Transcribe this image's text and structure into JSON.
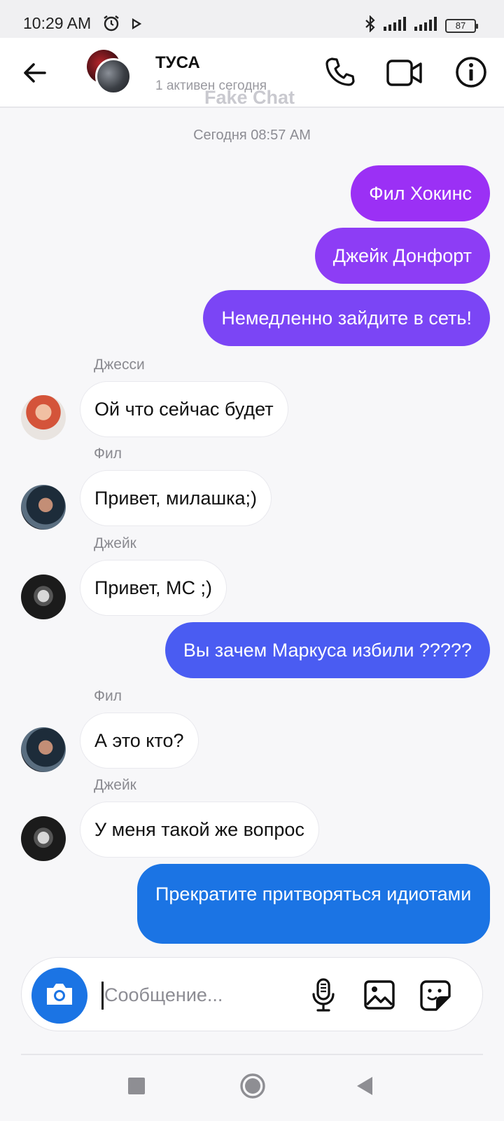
{
  "status_bar": {
    "time": "10:29 AM",
    "battery": "87",
    "icons": [
      "alarm-icon",
      "play-icon",
      "bluetooth-icon",
      "signal-icon",
      "signal-icon",
      "battery-icon"
    ]
  },
  "header": {
    "title": "ТУСА",
    "subtitle": "1 активен сегодня",
    "watermark": "Fake Chat",
    "icons": [
      "back-arrow-icon",
      "phone-icon",
      "video-camera-icon",
      "info-icon"
    ]
  },
  "date_separator": "Сегодня 08:57 AM",
  "messages": [
    {
      "direction": "out",
      "text": "Фил Хокинс"
    },
    {
      "direction": "out",
      "text": "Джейк Донфорт"
    },
    {
      "direction": "out",
      "text": "Немедленно зайдите в сеть!"
    },
    {
      "direction": "in",
      "sender": "Джесси",
      "text": "Ой что сейчас будет"
    },
    {
      "direction": "in",
      "sender": "Фил",
      "text": "Привет, милашка;)"
    },
    {
      "direction": "in",
      "sender": "Джейк",
      "text": "Привет, МС ;)"
    },
    {
      "direction": "out",
      "text": "Вы зачем Маркуса избили ?????"
    },
    {
      "direction": "in",
      "sender": "Фил",
      "text": "А это кто?"
    },
    {
      "direction": "in",
      "sender": "Джейк",
      "text": "У меня такой же вопрос"
    },
    {
      "direction": "out",
      "text": "Прекратите притворяться идиотами"
    }
  ],
  "colors": {
    "bubble_gradient": [
      "#9b30f5",
      "#8d3df5",
      "#7b45f5",
      "#4a5cf2",
      "#1b74e4"
    ],
    "accent": "#1b74e4"
  },
  "composer": {
    "placeholder": "Сообщение...",
    "value": "",
    "icons": [
      "camera-icon",
      "microphone-icon",
      "image-icon",
      "sticker-icon"
    ]
  },
  "nav_bar": {
    "icons": [
      "recents-icon",
      "home-icon",
      "back-icon"
    ]
  }
}
